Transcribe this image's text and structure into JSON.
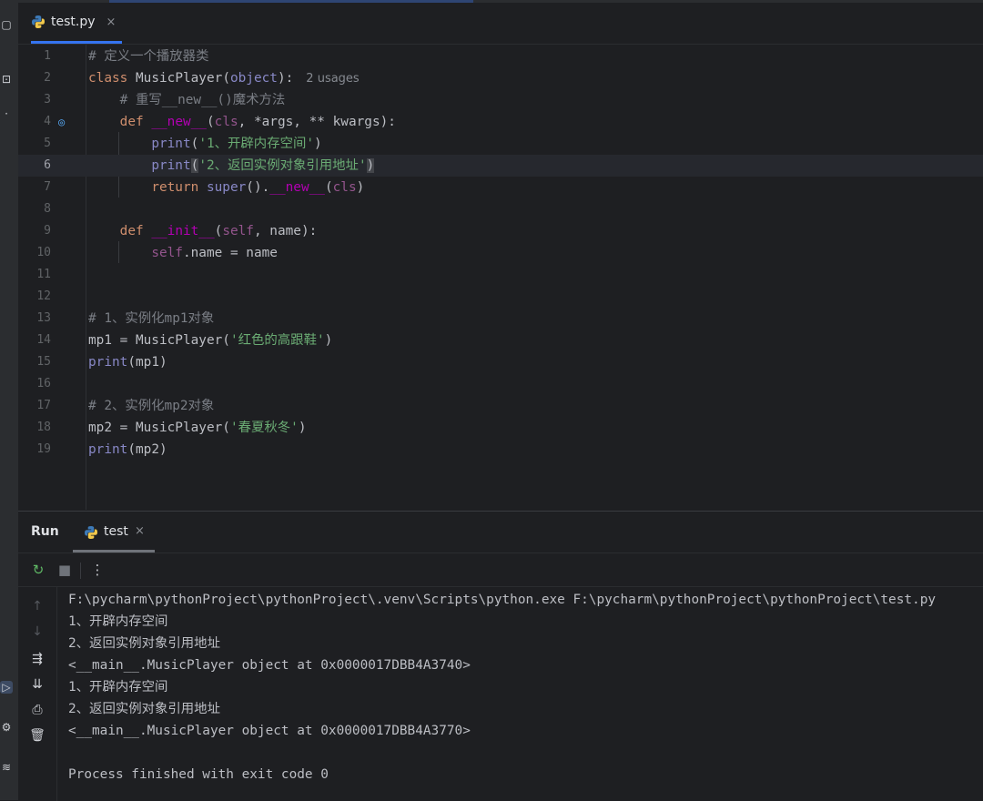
{
  "editor_tab": {
    "filename": "test.py",
    "close": "×"
  },
  "code": {
    "line_numbers": [
      "1",
      "2",
      "3",
      "4",
      "5",
      "6",
      "7",
      "8",
      "9",
      "10",
      "11",
      "12",
      "13",
      "14",
      "15",
      "16",
      "17",
      "18",
      "19"
    ],
    "l1_comment": "# 定义一个播放器类",
    "l2_class": "class",
    "l2_name": "MusicPlayer",
    "l2_paren_open": "(",
    "l2_base": "object",
    "l2_tail": "):",
    "l2_usages": "2 usages",
    "l3_comment": "# 重写__new__()魔术方法",
    "l4_def": "def",
    "l4_name": "__new__",
    "l4_open": "(",
    "l4_cls": "cls",
    "l4_rest": ", *args, ** kwargs):",
    "l5_print": "print",
    "l5_open": "(",
    "l5_str": "'1、开辟内存空间'",
    "l5_close": ")",
    "l6_print": "print",
    "l6_open": "(",
    "l6_str": "'2、返回实例对象引用地址'",
    "l6_close": ")",
    "l7_return": "return",
    "l7_super": "super",
    "l7_mid": "().",
    "l7_new": "__new__",
    "l7_open": "(",
    "l7_cls": "cls",
    "l7_close": ")",
    "l9_def": "def",
    "l9_name": "__init__",
    "l9_open": "(",
    "l9_self": "self",
    "l9_rest": ", name):",
    "l10_self": "self",
    "l10_rest": ".name = name",
    "l13_comment": "# 1、实例化mp1对象",
    "l14_head": "mp1 = MusicPlayer(",
    "l14_str": "'红色的高跟鞋'",
    "l14_close": ")",
    "l15_print": "print",
    "l15_rest": "(mp1)",
    "l17_comment": "# 2、实例化mp2对象",
    "l18_head": "mp2 = MusicPlayer(",
    "l18_str": "'春夏秋冬'",
    "l18_close": ")",
    "l19_print": "print",
    "l19_rest": "(mp2)"
  },
  "run_panel": {
    "title": "Run",
    "tab_label": "test",
    "tab_close": "×",
    "console_lines": [
      "F:\\pycharm\\pythonProject\\pythonProject\\.venv\\Scripts\\python.exe F:\\pycharm\\pythonProject\\pythonProject\\test.py",
      "1、开辟内存空间",
      "2、返回实例对象引用地址",
      "<__main__.MusicPlayer object at 0x0000017DBB4A3740>",
      "1、开辟内存空间",
      "2、返回实例对象引用地址",
      "<__main__.MusicPlayer object at 0x0000017DBB4A3770>",
      "",
      "Process finished with exit code 0"
    ]
  },
  "icons": {
    "python": "python-icon",
    "rerun": "rerun-icon",
    "stop": "stop-icon",
    "more": "more-icon",
    "up": "arrow-up-icon",
    "down": "arrow-down-icon",
    "wrap": "soft-wrap-icon",
    "scroll_end": "scroll-to-end-icon",
    "print": "print-icon",
    "trash": "trash-icon",
    "override": "override-marker-icon"
  },
  "colors": {
    "accent": "#3574f0",
    "keyword": "#cf8e6d",
    "string": "#6aab73",
    "comment": "#7a7e85",
    "dunder": "#b200b2",
    "self": "#94558d",
    "builtin": "#8888c6",
    "function": "#56a8f5"
  }
}
